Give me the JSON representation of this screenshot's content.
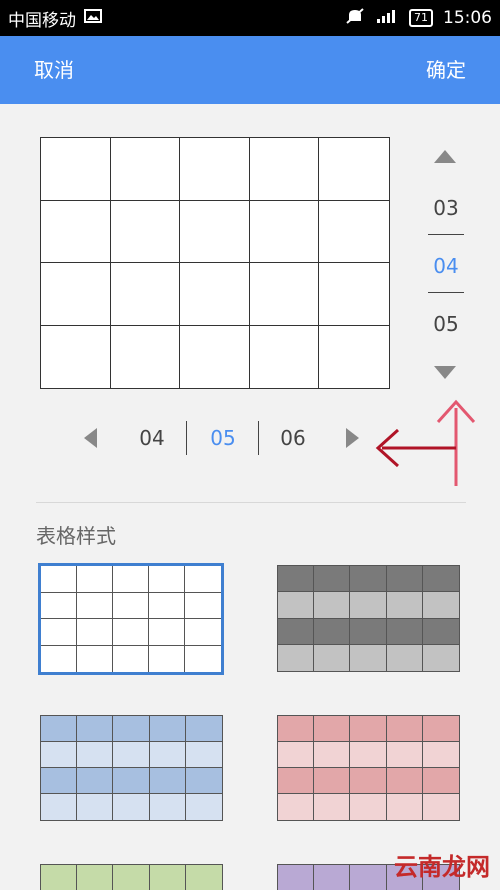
{
  "status_bar": {
    "carrier": "中国移动",
    "battery": "71",
    "time": "15:06"
  },
  "app_bar": {
    "cancel_label": "取消",
    "confirm_label": "确定"
  },
  "row_picker": {
    "prev": "03",
    "selected": "04",
    "next": "05"
  },
  "column_picker": {
    "prev": "04",
    "selected": "05",
    "next": "06"
  },
  "table_styles": {
    "title": "表格样式"
  },
  "colors": {
    "accent": "#4a8ef0",
    "selected_text": "#4a8ef0",
    "annotation_arrow": "#c0172b"
  },
  "watermark": "云南龙网"
}
